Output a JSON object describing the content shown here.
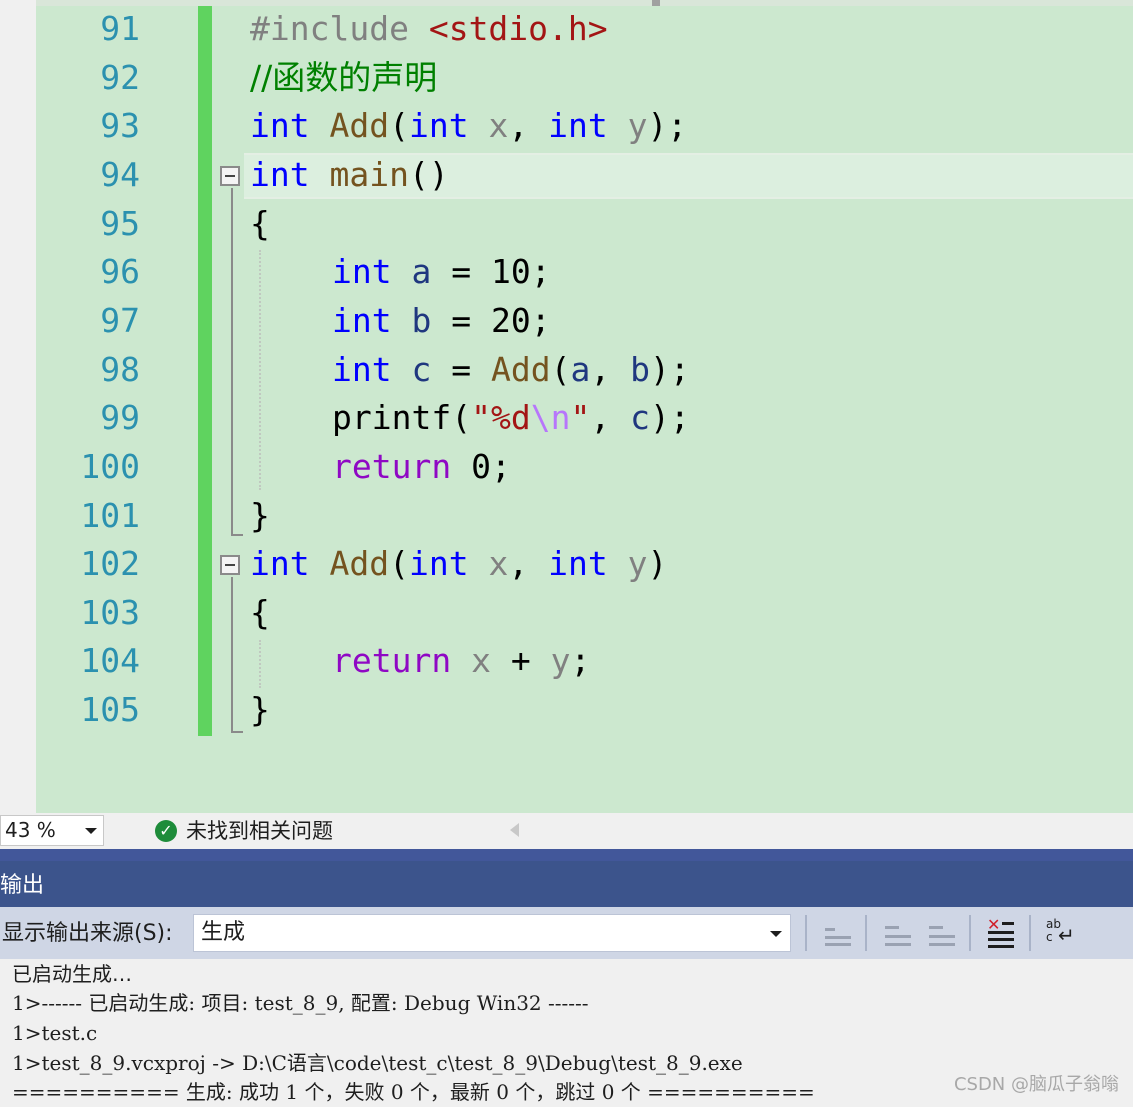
{
  "editor": {
    "line_numbers": [
      "91",
      "92",
      "93",
      "94",
      "95",
      "96",
      "97",
      "98",
      "99",
      "100",
      "101",
      "102",
      "103",
      "104",
      "105"
    ],
    "lines": {
      "l91": {
        "directive": "#include",
        "header": "<stdio.h>"
      },
      "l92": {
        "comment": "//函数的声明"
      },
      "l93": {
        "kw1": "int",
        "fn": "Add",
        "p_open": "(",
        "kw2": "int",
        "param1": "x",
        "comma": ", ",
        "kw3": "int",
        "param2": "y",
        "tail": ");"
      },
      "l94": {
        "kw": "int",
        "fn": "main",
        "tail": "()"
      },
      "l95": {
        "brace": "{"
      },
      "l96": {
        "kw": "int",
        "var": "a",
        "op": " = ",
        "num": "10",
        "tail": ";"
      },
      "l97": {
        "kw": "int",
        "var": "b",
        "op": " = ",
        "num": "20",
        "tail": ";"
      },
      "l98": {
        "kw": "int",
        "var": "c",
        "op": " = ",
        "fn": "Add",
        "p_open": "(",
        "arg1": "a",
        "comma": ", ",
        "arg2": "b",
        "tail": ");"
      },
      "l99": {
        "fn": "printf",
        "p_open": "(",
        "str1": "\"%d",
        "esc": "\\n",
        "str2": "\"",
        "comma": ", ",
        "arg": "c",
        "tail": ");"
      },
      "l100": {
        "kw": "return",
        "num": " 0",
        "tail": ";"
      },
      "l101": {
        "brace": "}"
      },
      "l102": {
        "kw1": "int",
        "fn": "Add",
        "p_open": "(",
        "kw2": "int",
        "param1": "x",
        "comma": ", ",
        "kw3": "int",
        "param2": "y",
        "tail": ")"
      },
      "l103": {
        "brace": "{"
      },
      "l104": {
        "kw": "return",
        "x": "x",
        "op": " + ",
        "y": "y",
        "tail": ";"
      },
      "l105": {
        "brace": "}"
      }
    }
  },
  "status_bar": {
    "zoom": "43 %",
    "issues_text": "未找到相关问题"
  },
  "output_panel": {
    "title": "输出",
    "source_label": "显示输出来源(S):",
    "source_value": "生成",
    "lines": [
      "已启动生成…",
      "1>------ 已启动生成: 项目: test_8_9, 配置: Debug Win32 ------",
      "1>test.c",
      "1>test_8_9.vcxproj -> D:\\C语言\\code\\test_c\\test_8_9\\Debug\\test_8_9.exe",
      "========== 生成: 成功 1 个，失败 0 个，最新 0 个，跳过 0 个 =========="
    ]
  },
  "watermark": "CSDN @脑瓜子翁嗡",
  "icons": [
    "check-circle-icon",
    "dropdown-arrow-icon",
    "find-message-icon",
    "prev-message-icon",
    "next-message-icon",
    "clear-all-icon",
    "word-wrap-icon"
  ],
  "colors": {
    "editor_bg": "#cce8cf",
    "keyword": "#0000ff",
    "function": "#74531f",
    "line_number": "#2b91af",
    "panel_title": "#3c548c"
  }
}
